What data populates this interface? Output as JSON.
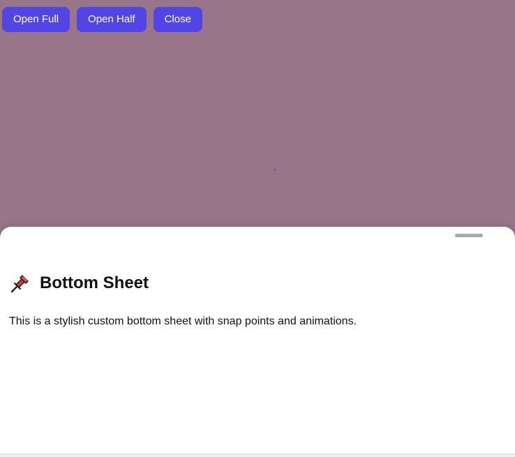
{
  "toolbar": {
    "open_full_label": "Open Full",
    "open_half_label": "Open Half",
    "close_label": "Close"
  },
  "sheet": {
    "title": "Bottom Sheet",
    "body": "This is a stylish custom bottom sheet with snap points and animations.",
    "title_icon": "pushpin-icon",
    "snap_state": "half"
  },
  "colors": {
    "backdrop": "#987589",
    "button": "#5145e6",
    "sheet_background": "#ffffff",
    "handle": "#a9a9a9"
  }
}
